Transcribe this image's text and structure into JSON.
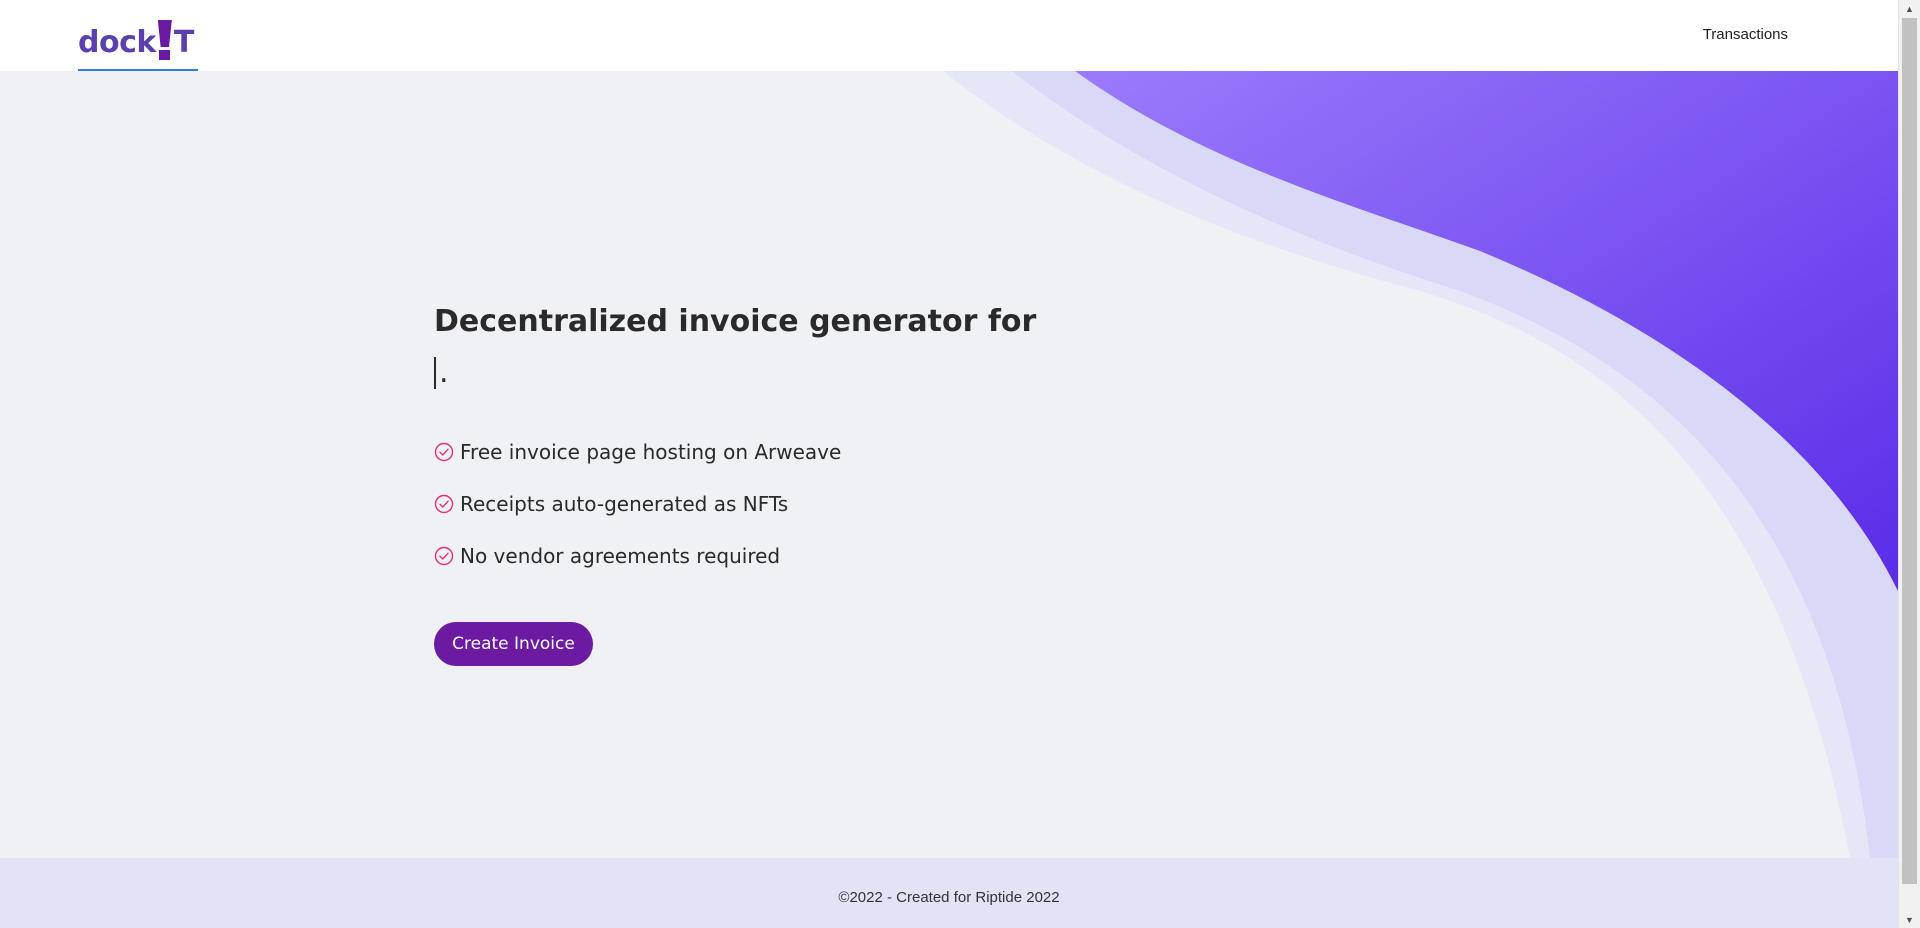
{
  "header": {
    "logo_prefix": "dock",
    "logo_suffix": "T",
    "nav_transactions": "Transactions"
  },
  "hero": {
    "title": "Decentralized invoice generator for",
    "typed_suffix": ".",
    "features": [
      {
        "label": "Free invoice page hosting on Arweave",
        "icon": "check-circle-icon"
      },
      {
        "label": "Receipts auto-generated as NFTs",
        "icon": "check-circle-icon"
      },
      {
        "label": "No vendor agreements required",
        "icon": "check-circle-icon"
      }
    ],
    "cta_label": "Create Invoice"
  },
  "footer": {
    "text": "©2022 - Created for Riptide 2022"
  },
  "colors": {
    "brand": "#5b3fae",
    "accent": "#6c1aa1",
    "check": "#e0307a",
    "wave_start": "#9b7bfb",
    "wave_end": "#5a2ce8",
    "background": "#f0f1f5",
    "footer_bg": "#e3e3f7"
  }
}
